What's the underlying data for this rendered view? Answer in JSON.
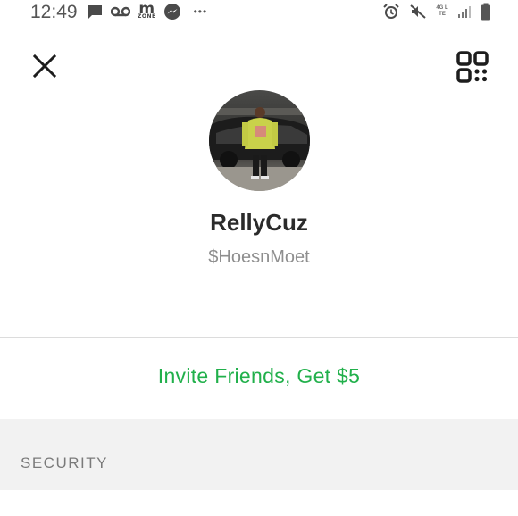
{
  "status_bar": {
    "time": "12:49",
    "notification_icons": [
      "message-icon",
      "voicemail-icon",
      "mzone-icon",
      "messenger-icon",
      "more-dots-icon"
    ],
    "mzone_text": "m",
    "mzone_subtext": "ZONE",
    "more_text": "•••",
    "system_icons": [
      "alarm-icon",
      "mute-icon",
      "4g-lte-icon",
      "signal-icon",
      "battery-icon"
    ],
    "network_label": "4G LTE"
  },
  "profile": {
    "display_name": "RellyCuz",
    "cashtag": "$HoesnMoet"
  },
  "actions": {
    "invite_label": "Invite Friends, Get $5"
  },
  "sections": {
    "security_header": "SECURITY"
  },
  "colors": {
    "accent_green": "#21b04b",
    "section_background": "#f2f2f2",
    "avatar_hoodie": "#c9d14a"
  }
}
